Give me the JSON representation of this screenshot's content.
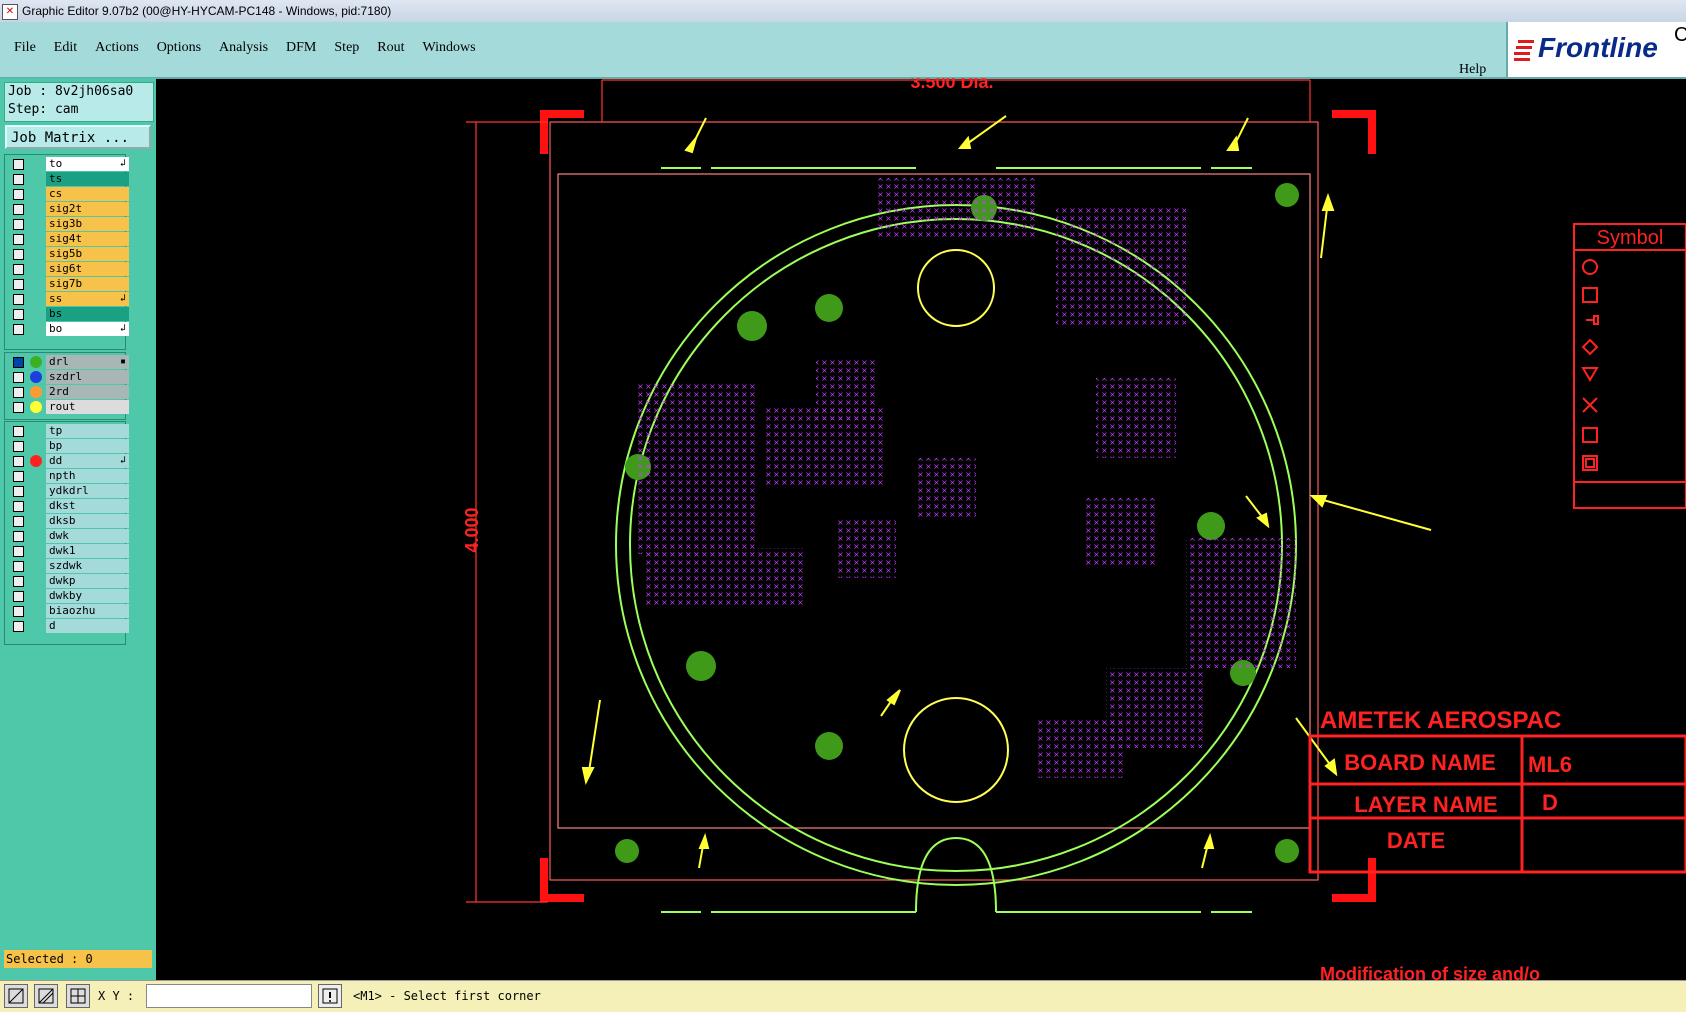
{
  "window": {
    "title": "Graphic Editor 9.07b2 (00@HY-HYCAM-PC148 - Windows, pid:7180)"
  },
  "menu": [
    "File",
    "Edit",
    "Actions",
    "Options",
    "Analysis",
    "DFM",
    "Step",
    "Rout",
    "Windows"
  ],
  "help_label": "Help",
  "logo_text": "Frontline",
  "logo_tail": "C",
  "job": {
    "job_line": "Job : 8v2jh06sa0",
    "step_line": "Step: cam",
    "matrix_button": "Job Matrix ..."
  },
  "layers": {
    "group1": [
      {
        "name": "to",
        "color": "#ffffff",
        "mark": "↲"
      },
      {
        "name": "ts",
        "color": "#1aa083",
        "mark": ""
      },
      {
        "name": "cs",
        "color": "#f6c24a",
        "mark": ""
      },
      {
        "name": "sig2t",
        "color": "#f6c24a",
        "mark": ""
      },
      {
        "name": "sig3b",
        "color": "#f6c24a",
        "mark": ""
      },
      {
        "name": "sig4t",
        "color": "#f6c24a",
        "mark": ""
      },
      {
        "name": "sig5b",
        "color": "#f6c24a",
        "mark": ""
      },
      {
        "name": "sig6t",
        "color": "#f6c24a",
        "mark": ""
      },
      {
        "name": "sig7b",
        "color": "#f6c24a",
        "mark": ""
      },
      {
        "name": "ss",
        "color": "#f6c24a",
        "mark": "↲"
      },
      {
        "name": "bs",
        "color": "#1aa083",
        "mark": ""
      },
      {
        "name": "bo",
        "color": "#ffffff",
        "mark": "↲"
      }
    ],
    "group2": [
      {
        "name": "drl",
        "color": "#a9b6b6",
        "dot": "#3cb023",
        "mark": "▪"
      },
      {
        "name": "szdrl",
        "color": "#a9b6b6",
        "dot": "#1d3fe0",
        "mark": ""
      },
      {
        "name": "2rd",
        "color": "#a9b6b6",
        "dot": "#ff9a33",
        "mark": ""
      },
      {
        "name": "rout",
        "color": "#dcdcdc",
        "dot": "#ffff33",
        "mark": ""
      }
    ],
    "group3": [
      {
        "name": "tp",
        "color": "#a4dada",
        "dot": "",
        "mark": ""
      },
      {
        "name": "bp",
        "color": "#a4dada",
        "dot": "",
        "mark": ""
      },
      {
        "name": "dd",
        "color": "#a4dada",
        "dot": "#ff2222",
        "mark": "↲"
      },
      {
        "name": "npth",
        "color": "#a4dada",
        "dot": "",
        "mark": ""
      },
      {
        "name": "ydkdrl",
        "color": "#a4dada",
        "dot": "",
        "mark": ""
      },
      {
        "name": "dkst",
        "color": "#a4dada",
        "dot": "",
        "mark": ""
      },
      {
        "name": "dksb",
        "color": "#a4dada",
        "dot": "",
        "mark": ""
      },
      {
        "name": "dwk",
        "color": "#a4dada",
        "dot": "",
        "mark": ""
      },
      {
        "name": "dwk1",
        "color": "#a4dada",
        "dot": "",
        "mark": ""
      },
      {
        "name": "szdwk",
        "color": "#a4dada",
        "dot": "",
        "mark": ""
      },
      {
        "name": "dwkp",
        "color": "#a4dada",
        "dot": "",
        "mark": ""
      },
      {
        "name": "dwkby",
        "color": "#a4dada",
        "dot": "",
        "mark": ""
      },
      {
        "name": "biaozhu",
        "color": "#a4dada",
        "dot": "",
        "mark": ""
      },
      {
        "name": "d",
        "color": "#a4dada",
        "dot": "",
        "mark": ""
      }
    ]
  },
  "selected_label": "Selected : 0",
  "status": {
    "xy_label": "X Y :",
    "prompt": "<M1> - Select first corner",
    "xy_value": ""
  },
  "drawing": {
    "dim_width": "3.500 Dia.",
    "dim_height": "4.000",
    "symbol_title": "Symbol",
    "company": "AMETEK AEROSPAC",
    "board_name": "BOARD NAME",
    "board_name_value": "ML6",
    "layer_name": "LAYER NAME",
    "layer_name_value": "D",
    "date": "DATE",
    "footer": "Modification of size and/o"
  }
}
